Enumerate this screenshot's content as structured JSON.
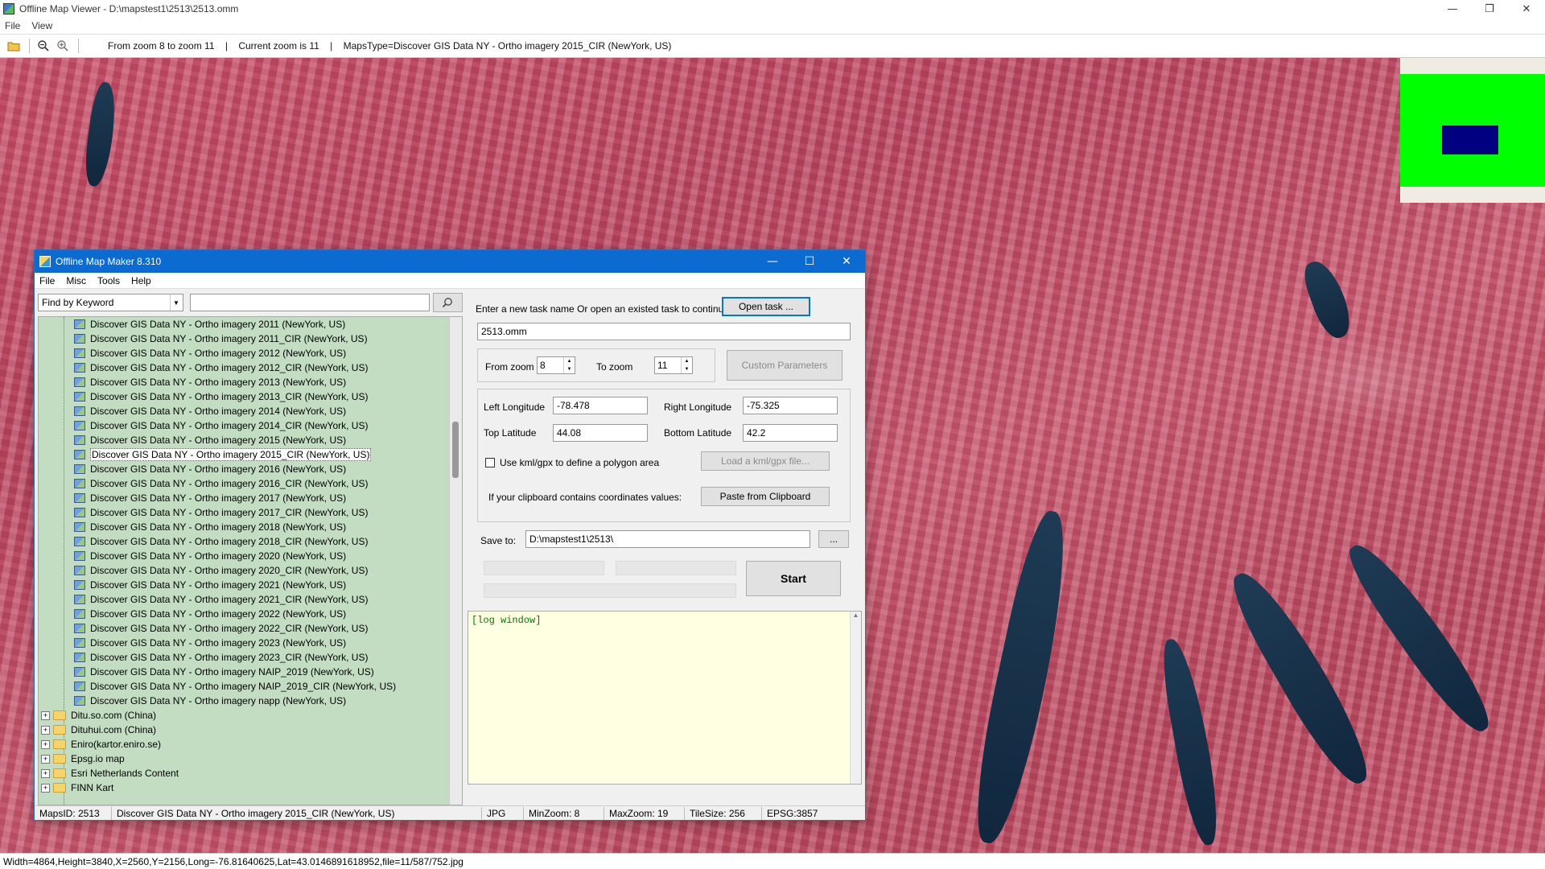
{
  "viewer": {
    "title": "Offline Map Viewer - D:\\mapstest1\\2513\\2513.omm",
    "controls": {
      "minimize": "—",
      "restore": "❐",
      "close": "✕"
    },
    "menu": [
      "File",
      "View"
    ],
    "toolbar": {
      "zoom_range": "From zoom 8 to zoom 11",
      "current_zoom": "Current zoom is 11",
      "maps_type": "MapsType=Discover GIS Data NY - Ortho imagery 2015_CIR (NewYork, US)"
    },
    "status": "Width=4864,Height=3840,X=2560,Y=2156,Long=-76.81640625,Lat=43.0146891618952,file=11/587/752.jpg"
  },
  "maker": {
    "title": "Offline Map Maker 8.310",
    "controls": {
      "minimize": "—",
      "maximize": "☐",
      "close": "✕"
    },
    "menu": [
      "File",
      "Misc",
      "Tools",
      "Help"
    ],
    "search": {
      "mode": "Find by Keyword",
      "keyword": "",
      "button_icon": "search-icon"
    },
    "tree": {
      "leaves": [
        "Discover GIS Data NY - Ortho imagery 2011 (NewYork, US)",
        "Discover GIS Data NY - Ortho imagery 2011_CIR (NewYork, US)",
        "Discover GIS Data NY - Ortho imagery 2012 (NewYork, US)",
        "Discover GIS Data NY - Ortho imagery 2012_CIR (NewYork, US)",
        "Discover GIS Data NY - Ortho imagery 2013 (NewYork, US)",
        "Discover GIS Data NY - Ortho imagery 2013_CIR (NewYork, US)",
        "Discover GIS Data NY - Ortho imagery 2014 (NewYork, US)",
        "Discover GIS Data NY - Ortho imagery 2014_CIR (NewYork, US)",
        "Discover GIS Data NY - Ortho imagery 2015 (NewYork, US)",
        "Discover GIS Data NY - Ortho imagery 2015_CIR (NewYork, US)",
        "Discover GIS Data NY - Ortho imagery 2016 (NewYork, US)",
        "Discover GIS Data NY - Ortho imagery 2016_CIR (NewYork, US)",
        "Discover GIS Data NY - Ortho imagery 2017 (NewYork, US)",
        "Discover GIS Data NY - Ortho imagery 2017_CIR (NewYork, US)",
        "Discover GIS Data NY - Ortho imagery 2018 (NewYork, US)",
        "Discover GIS Data NY - Ortho imagery 2018_CIR (NewYork, US)",
        "Discover GIS Data NY - Ortho imagery 2020 (NewYork, US)",
        "Discover GIS Data NY - Ortho imagery 2020_CIR (NewYork, US)",
        "Discover GIS Data NY - Ortho imagery 2021 (NewYork, US)",
        "Discover GIS Data NY - Ortho imagery 2021_CIR (NewYork, US)",
        "Discover GIS Data NY - Ortho imagery 2022 (NewYork, US)",
        "Discover GIS Data NY - Ortho imagery 2022_CIR (NewYork, US)",
        "Discover GIS Data NY - Ortho imagery 2023 (NewYork, US)",
        "Discover GIS Data NY - Ortho imagery 2023_CIR (NewYork, US)",
        "Discover GIS Data NY - Ortho imagery NAIP_2019 (NewYork, US)",
        "Discover GIS Data NY - Ortho imagery NAIP_2019_CIR (NewYork, US)",
        "Discover GIS Data NY - Ortho imagery napp (NewYork, US)"
      ],
      "selected_index": 9,
      "folders": [
        "Ditu.so.com (China)",
        "Dituhui.com (China)",
        "Eniro(kartor.eniro.se)",
        "Epsg.io map",
        "Esri Netherlands Content",
        "FINN Kart"
      ]
    },
    "task": {
      "prompt": "Enter a new task name Or open an existed task to continue:",
      "open_button": "Open task ...",
      "name": "2513.omm"
    },
    "zoom": {
      "from_label": "From zoom",
      "from_value": "8",
      "to_label": "To zoom",
      "to_value": "11",
      "custom_button": "Custom Parameters"
    },
    "coords": {
      "left_lon_label": "Left Longitude",
      "left_lon": "-78.478",
      "right_lon_label": "Right Longitude",
      "right_lon": "-75.325",
      "top_lat_label": "Top Latitude",
      "top_lat": "44.08",
      "bottom_lat_label": "Bottom Latitude",
      "bottom_lat": "42.2",
      "kml_label": "Use kml/gpx to define a polygon area",
      "kml_checked": false,
      "kml_button": "Load a kml/gpx file...",
      "clipboard_label": "If your clipboard contains coordinates values:",
      "clipboard_button": "Paste from Clipboard"
    },
    "save": {
      "label": "Save to:",
      "path": "D:\\mapstest1\\2513\\",
      "browse": "...",
      "start": "Start"
    },
    "log": "[log window]",
    "status": {
      "maps_id": "MapsID: 2513",
      "name": "Discover GIS Data NY - Ortho imagery 2015_CIR (NewYork, US)",
      "format": "JPG",
      "min_zoom": "MinZoom: 8",
      "max_zoom": "MaxZoom: 19",
      "tile_size": "TileSize: 256",
      "epsg": "EPSG:3857"
    }
  }
}
